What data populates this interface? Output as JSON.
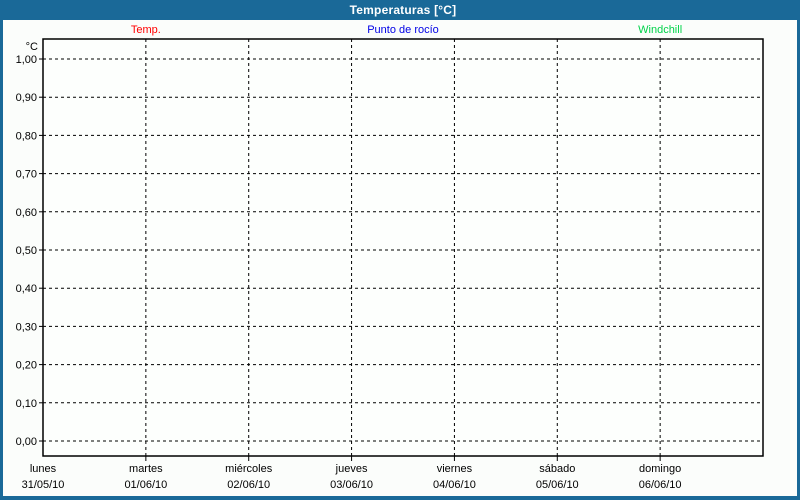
{
  "title": "Temperaturas [°C]",
  "legend": [
    {
      "label": "Temp.",
      "color": "#ff0000"
    },
    {
      "label": "Punto de rocío",
      "color": "#0000e6"
    },
    {
      "label": "Windchill",
      "color": "#00d24a"
    }
  ],
  "colors": {
    "title_bar_bg": "#1a6998",
    "frame": "#1a6998",
    "background": "#fbfdfb",
    "plot_background": "#fdfffd",
    "grid": "#000000",
    "axis_text": "#000000",
    "title_text": "#ffffff"
  },
  "chart_data": {
    "type": "line",
    "title": "Temperaturas [°C]",
    "unit_label": "°C",
    "ylabel": "°C",
    "ylim": [
      0.0,
      1.0
    ],
    "ytick_step": 0.1,
    "yticks": [
      "1,00",
      "0,90",
      "0,80",
      "0,70",
      "0,60",
      "0,50",
      "0,40",
      "0,30",
      "0,20",
      "0,10",
      "0,00"
    ],
    "x_days": [
      {
        "day": "lunes",
        "date": "31/05/10"
      },
      {
        "day": "martes",
        "date": "01/06/10"
      },
      {
        "day": "miércoles",
        "date": "02/06/10"
      },
      {
        "day": "jueves",
        "date": "03/06/10"
      },
      {
        "day": "viernes",
        "date": "04/06/10"
      },
      {
        "day": "sábado",
        "date": "05/06/10"
      },
      {
        "day": "domingo",
        "date": "06/06/10"
      }
    ],
    "series": [
      {
        "name": "Temp.",
        "color": "#ff0000",
        "values": []
      },
      {
        "name": "Punto de rocío",
        "color": "#0000e6",
        "values": []
      },
      {
        "name": "Windchill",
        "color": "#00d24a",
        "values": []
      }
    ],
    "grid": "dashed",
    "legend_position": "top"
  }
}
